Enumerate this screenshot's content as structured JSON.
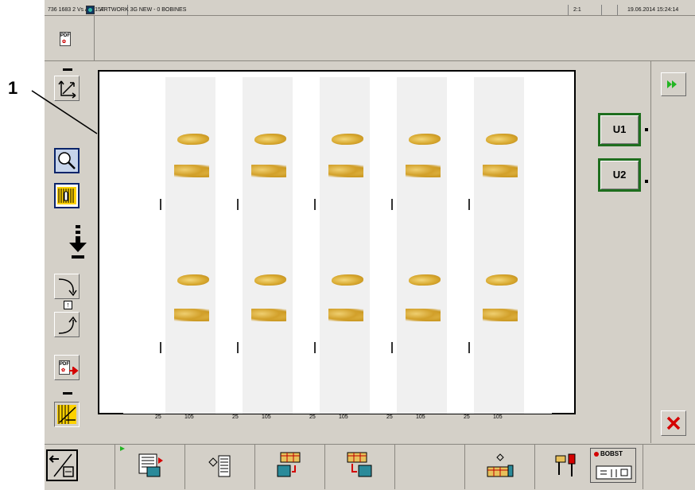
{
  "titlebar": {
    "job": "736 1683 2 Vs A pr157",
    "title": "ARTWORK 3G NEW - 0 BOBINES",
    "zoom": "2:1",
    "datetime": "19.06.2014 15:24:14"
  },
  "toolbar_top": {
    "pdf_label": "PDF"
  },
  "left_tools": {
    "pdf_label": "PDF"
  },
  "callout": "1",
  "canvas": {
    "dimension_labels": [
      {
        "a": "25",
        "b": "105"
      },
      {
        "a": "25",
        "b": "105"
      },
      {
        "a": "25",
        "b": "105"
      },
      {
        "a": "25",
        "b": "105"
      },
      {
        "a": "25",
        "b": "105"
      }
    ]
  },
  "right_panel": {
    "u1_label": "U1",
    "u2_label": "U2"
  },
  "bottom_bar": {
    "logo_text": "BOBST"
  },
  "colors": {
    "accent_green": "#1e6e1e",
    "close_red": "#d40000",
    "ok_green": "#22b522"
  }
}
